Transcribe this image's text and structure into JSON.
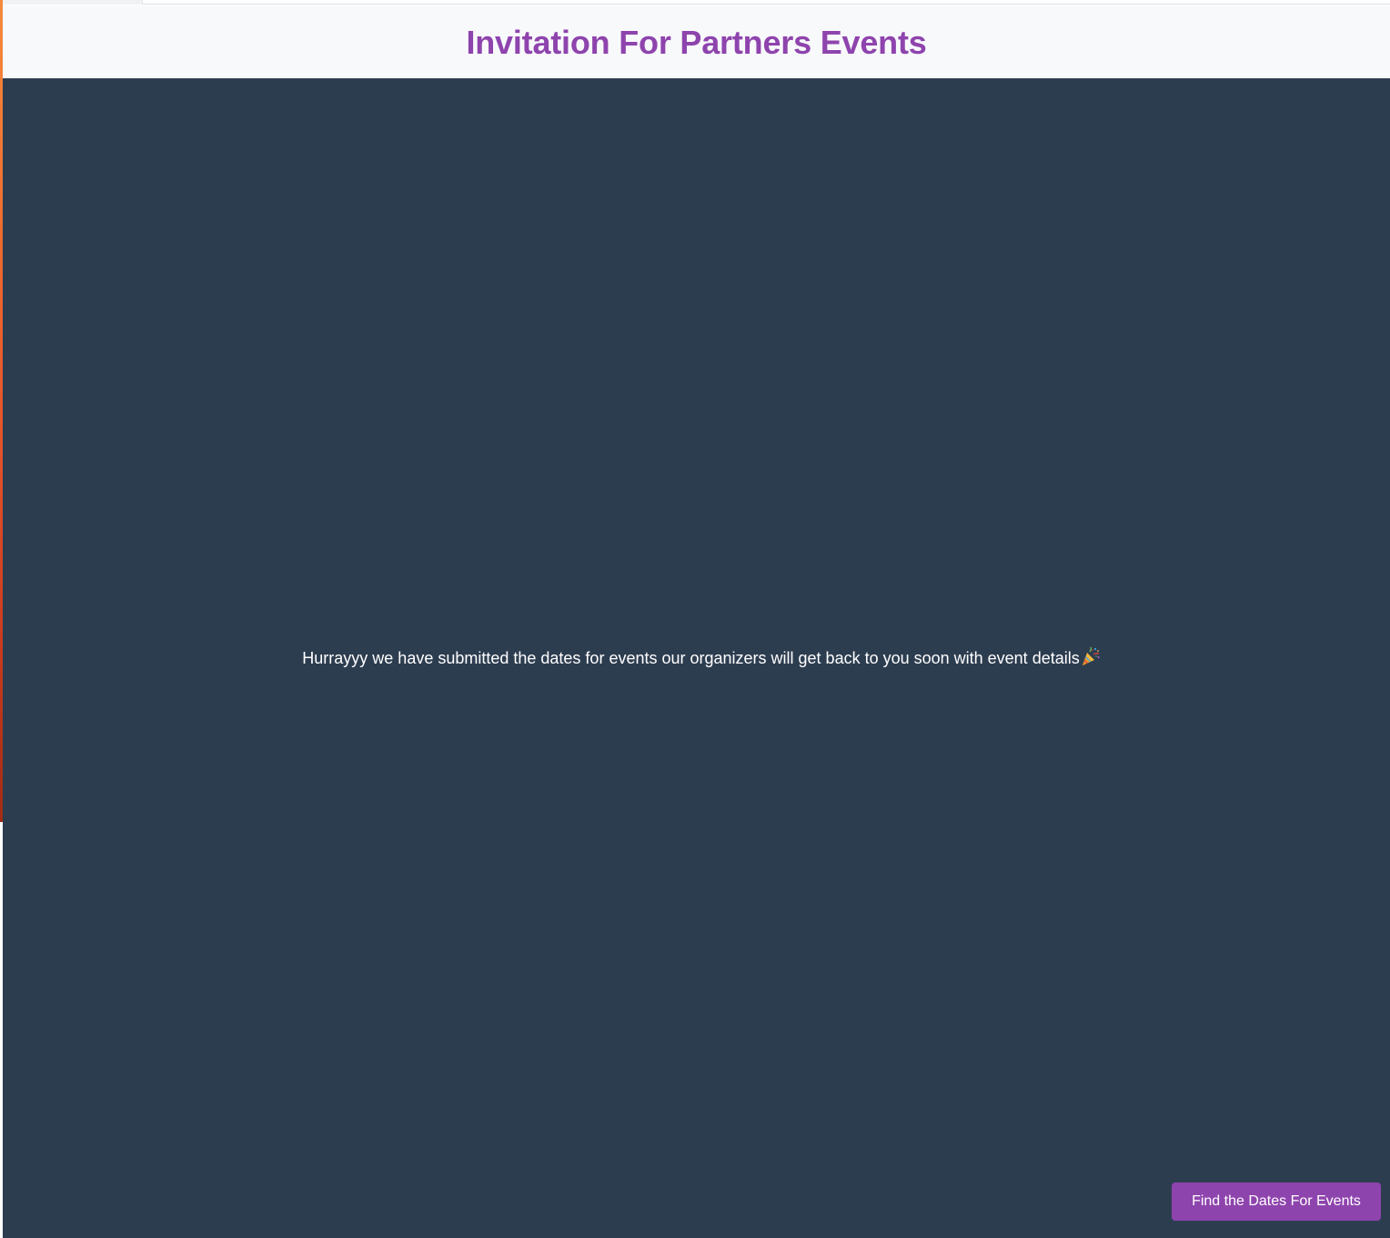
{
  "header": {
    "title": "Invitation For Partners Events"
  },
  "main": {
    "message": "Hurrayyy we have submitted the dates for events our organizers will get back to you soon with event details",
    "message_icon": "party-popper-icon"
  },
  "actions": {
    "find_dates_label": "Find the Dates For Events"
  },
  "colors": {
    "accent": "#8e44ad",
    "background": "#2d3d50",
    "header_background": "#f8f9fb",
    "text_light": "#ffffff"
  }
}
